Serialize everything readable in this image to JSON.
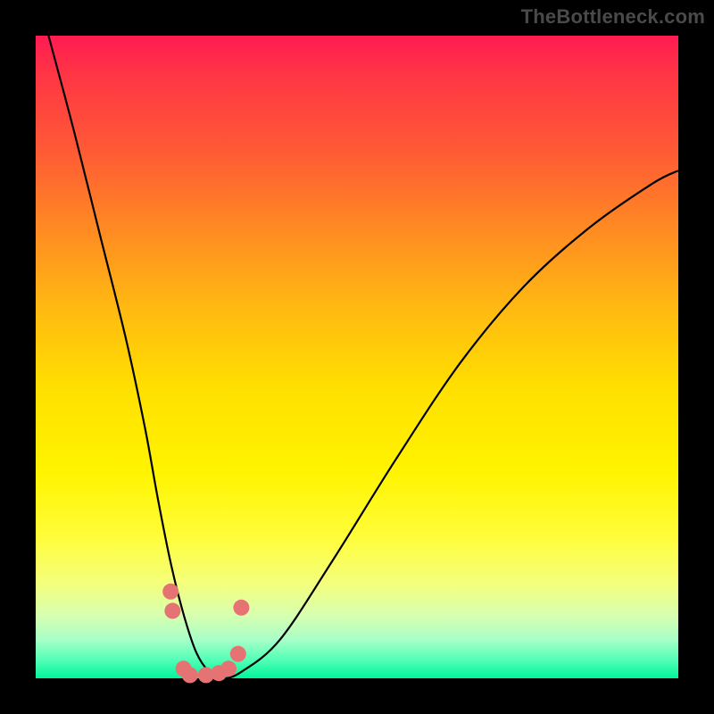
{
  "watermark": "TheBottleneck.com",
  "chart_data": {
    "type": "line",
    "title": "",
    "xlabel": "",
    "ylabel": "",
    "xlim": [
      0,
      100
    ],
    "ylim": [
      0,
      100
    ],
    "grid": false,
    "legend": false,
    "background_gradient": {
      "direction": "top-to-bottom",
      "stops": [
        {
          "pos": 0,
          "color": "#ff1b52"
        },
        {
          "pos": 30,
          "color": "#ff8a22"
        },
        {
          "pos": 55,
          "color": "#ffe000"
        },
        {
          "pos": 85,
          "color": "#f5ff7a"
        },
        {
          "pos": 100,
          "color": "#00f59a"
        }
      ]
    },
    "series": [
      {
        "name": "bottleneck-curve",
        "type": "line",
        "x": [
          2,
          6,
          10,
          14,
          17,
          19,
          21,
          23,
          25,
          27,
          29,
          32,
          38,
          46,
          56,
          66,
          76,
          86,
          96,
          100
        ],
        "y": [
          100,
          85,
          69,
          53,
          39,
          28,
          18,
          10,
          4,
          1,
          0,
          1,
          6,
          18,
          34,
          49,
          61,
          70,
          77,
          79
        ]
      },
      {
        "name": "scatter-points",
        "type": "scatter",
        "x": [
          21.0,
          21.3,
          23.0,
          24.0,
          26.5,
          28.5,
          30.0,
          31.5,
          32.0
        ],
        "y": [
          13.5,
          10.5,
          1.5,
          0.5,
          0.5,
          0.8,
          1.5,
          3.8,
          11.0
        ]
      }
    ]
  }
}
